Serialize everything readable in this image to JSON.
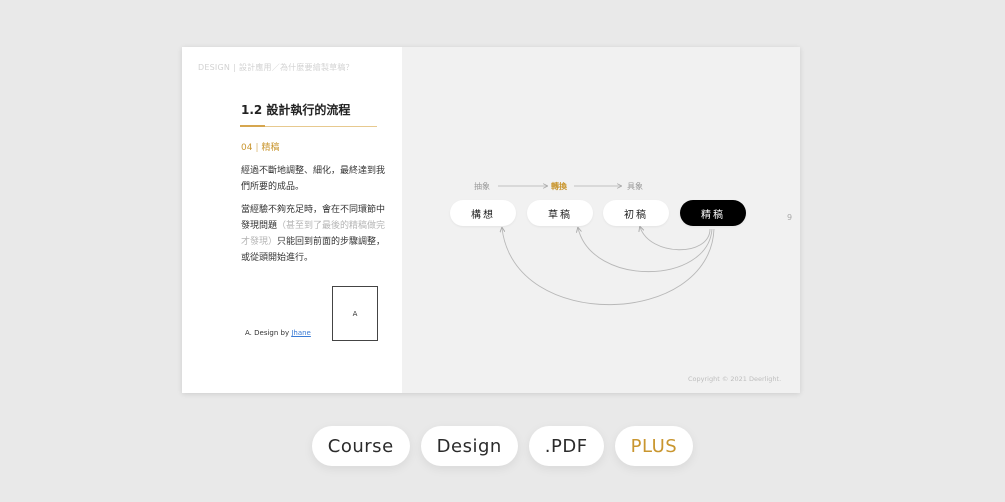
{
  "slide": {
    "breadcrumb": {
      "brand": "DESIGN",
      "sep": "|",
      "path": "設計應用／為什麼要繪製草稿？"
    },
    "title": "1.2 設計執行的流程",
    "step": {
      "number": "04",
      "sep": "|",
      "name": "精稿"
    },
    "paragraph1": "經過不斷地調整、細化，最終達到我們所要的成品。",
    "paragraph2": {
      "part1": "當經驗不夠充足時，會在不同環節中發現問題",
      "muted": "（甚至到了最後的精稿做完才發現）",
      "part2": "只能回到前面的步驟調整，或從頭開始進行。"
    },
    "thumbnail_label": "A",
    "credit": {
      "prefix": "A. Design by ",
      "author": "Jhane"
    },
    "diagram": {
      "top_labels": [
        "抽象",
        "轉換",
        "具象"
      ],
      "stages": [
        "構想",
        "草稿",
        "初稿",
        "精稿"
      ],
      "active_stage": "精稿"
    },
    "page_number": "9",
    "copyright": "Copyright © 2021 Deerlight."
  },
  "tags": [
    "Course",
    "Design",
    ".PDF",
    "PLUS"
  ],
  "colors": {
    "accent": "#c9962f",
    "background": "#e9e9e9",
    "active_pill": "#000000"
  }
}
